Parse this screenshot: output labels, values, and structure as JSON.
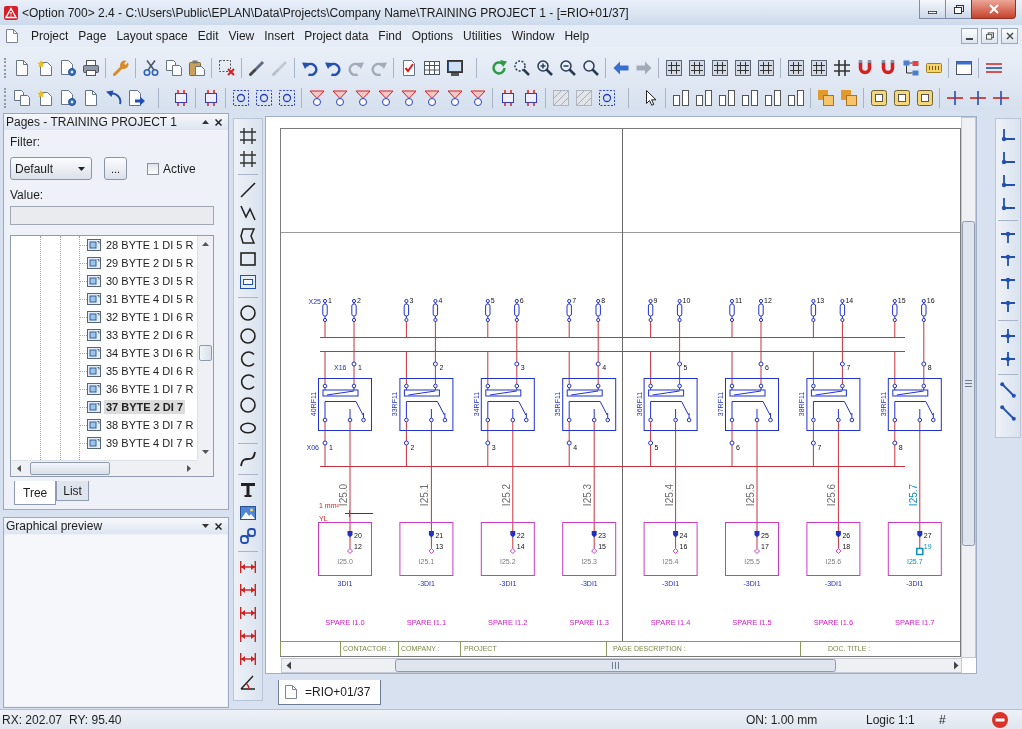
{
  "window": {
    "title": "<Option 700> 2.4 - C:\\Users\\Public\\EPLAN\\Data\\Projects\\Company Name\\TRAINING PROJECT 1 - [=RIO+01/37]"
  },
  "menu": [
    "Project",
    "Page",
    "Layout space",
    "Edit",
    "View",
    "Insert",
    "Project data",
    "Find",
    "Options",
    "Utilities",
    "Window",
    "Help"
  ],
  "pages_panel": {
    "title": "Pages - TRAINING PROJECT 1",
    "filter_label": "Filter:",
    "filter": "Default",
    "more_button": "...",
    "active": {
      "label": "Active",
      "checked": false
    },
    "value_label": "Value:",
    "pages": [
      {
        "label": "28 BYTE 1 DI 5 R",
        "selected": false
      },
      {
        "label": "29 BYTE 2 DI 5 R",
        "selected": false
      },
      {
        "label": "30 BYTE 3 DI 5 R",
        "selected": false
      },
      {
        "label": "31 BYTE 4 DI 5 R",
        "selected": false
      },
      {
        "label": "32 BYTE 1 DI 6 R",
        "selected": false
      },
      {
        "label": "33 BYTE 2 DI 6 R",
        "selected": false
      },
      {
        "label": "34 BYTE 3 DI 6 R",
        "selected": false
      },
      {
        "label": "35 BYTE 4 DI 6 R",
        "selected": false
      },
      {
        "label": "36 BYTE 1 DI 7 R",
        "selected": false
      },
      {
        "label": "37 BYTE 2 DI 7",
        "selected": true
      },
      {
        "label": "38 BYTE 3 DI 7 R",
        "selected": false
      },
      {
        "label": "39 BYTE 4 DI 7 R",
        "selected": false
      }
    ],
    "tabs": [
      {
        "label": "Tree",
        "selected": true
      },
      {
        "label": "List",
        "selected": false
      }
    ]
  },
  "preview_panel": {
    "title": "Graphical preview"
  },
  "schematic": {
    "strip_top": "X25",
    "strip_relay": "X16",
    "strip_bottom": "X06",
    "wire_label": "1 mm²",
    "wire_code": "YL",
    "channels": [
      {
        "terminals": [
          "1",
          "2"
        ],
        "relay": "40RF11",
        "relay_terminal": "1",
        "bottom_terminal": "1",
        "address": "I25.0",
        "plc_pins": [
          "20",
          "12"
        ],
        "plc_address": "I25.0",
        "device": "3DI1",
        "comment": "SPARE I1.0",
        "selected": false
      },
      {
        "terminals": [
          "3",
          "4"
        ],
        "relay": "33RF11",
        "relay_terminal": "2",
        "bottom_terminal": "2",
        "address": "I25.1",
        "plc_pins": [
          "21",
          "13"
        ],
        "plc_address": "I25.1",
        "device": "-3DI1",
        "comment": "SPARE I1.1",
        "selected": false
      },
      {
        "terminals": [
          "5",
          "6"
        ],
        "relay": "34RF11",
        "relay_terminal": "3",
        "bottom_terminal": "3",
        "address": "I25.2",
        "plc_pins": [
          "22",
          "14"
        ],
        "plc_address": "I25.2",
        "device": "-3DI1",
        "comment": "SPARE I1.2",
        "selected": false
      },
      {
        "terminals": [
          "7",
          "8"
        ],
        "relay": "35RF11",
        "relay_terminal": "4",
        "bottom_terminal": "4",
        "address": "I25.3",
        "plc_pins": [
          "23",
          "15"
        ],
        "plc_address": "I25.3",
        "device": "-3DI1",
        "comment": "SPARE I1.3",
        "selected": false
      },
      {
        "terminals": [
          "9",
          "10"
        ],
        "relay": "36RF11",
        "relay_terminal": "5",
        "bottom_terminal": "5",
        "address": "I25.4",
        "plc_pins": [
          "24",
          "16"
        ],
        "plc_address": "I25.4",
        "device": "-3DI1",
        "comment": "SPARE I1.4",
        "selected": false
      },
      {
        "terminals": [
          "11",
          "12"
        ],
        "relay": "37RF11",
        "relay_terminal": "6",
        "bottom_terminal": "6",
        "address": "I25.5",
        "plc_pins": [
          "25",
          "17"
        ],
        "plc_address": "I25.5",
        "device": "-3DI1",
        "comment": "SPARE I1.5",
        "selected": false
      },
      {
        "terminals": [
          "13",
          "14"
        ],
        "relay": "38RF11",
        "relay_terminal": "7",
        "bottom_terminal": "7",
        "address": "I25.6",
        "plc_pins": [
          "26",
          "18"
        ],
        "plc_address": "I25.6",
        "device": "-3DI1",
        "comment": "SPARE I1.6",
        "selected": false
      },
      {
        "terminals": [
          "15",
          "16"
        ],
        "relay": "39RF11",
        "relay_terminal": "8",
        "bottom_terminal": "8",
        "address": "I25.7",
        "plc_pins": [
          "27",
          "19"
        ],
        "plc_address": "I25.7",
        "device": "-3DI1",
        "comment": "SPARE I1.7",
        "selected": true
      }
    ],
    "title_block": [
      "CONTACTOR :",
      "COMPANY :",
      "PROJECT",
      "PAGE DESCRIPTION :",
      "DOC. TITLE :"
    ]
  },
  "page_tabs": [
    {
      "label": "=RIO+01/37",
      "selected": true
    }
  ],
  "status_bar": {
    "rx": "RX: 202.07",
    "ry": "RY: 95.40",
    "grid": "ON: 1.00 mm",
    "scale": "Logic 1:1",
    "snap": "#"
  }
}
